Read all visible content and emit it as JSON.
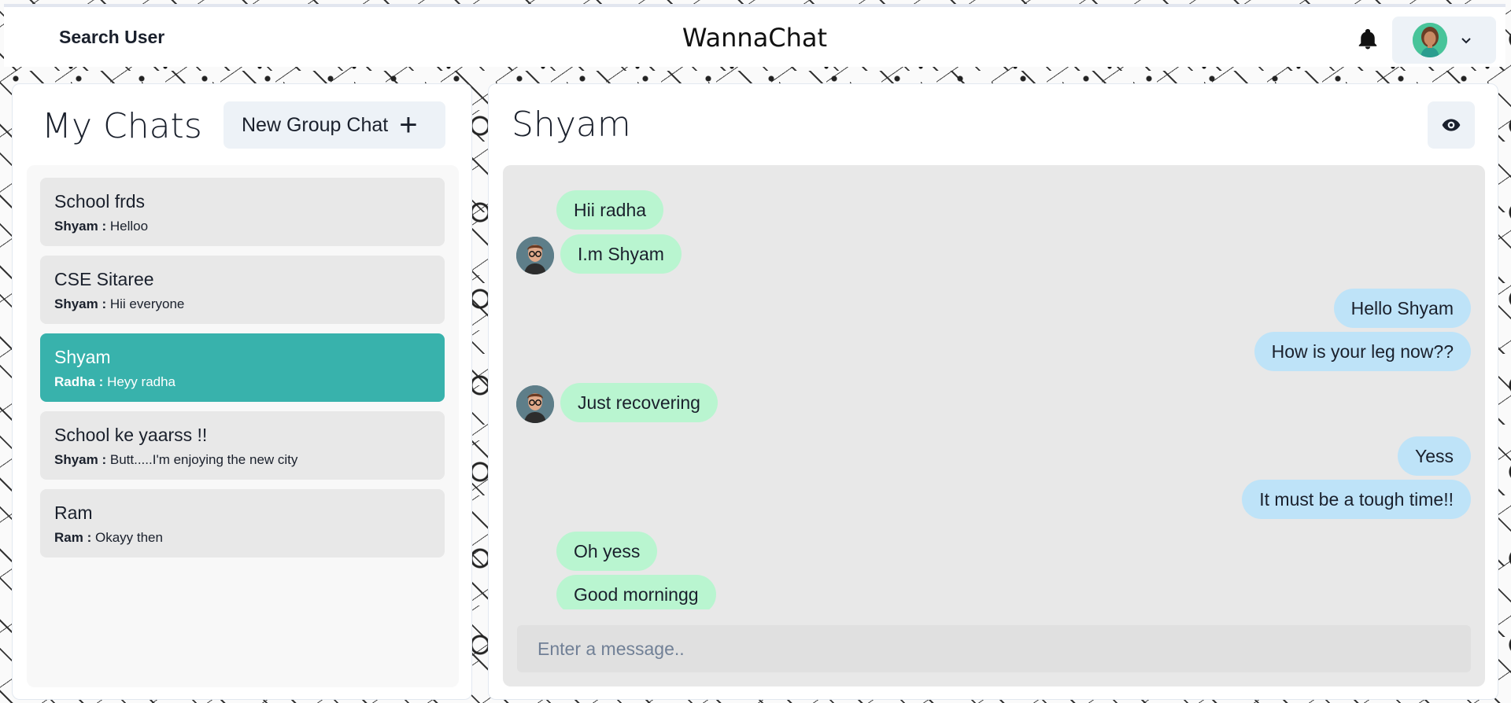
{
  "header": {
    "search_label": "Search User",
    "app_title": "WannaChat",
    "icons": [
      "bell-icon",
      "chevron-down-icon"
    ]
  },
  "left_panel": {
    "title": "My Chats",
    "new_group_label": "New Group Chat",
    "new_group_icon": "+",
    "chats": [
      {
        "name": "School frds",
        "sender": "Shyam :",
        "preview": "Helloo",
        "active": false
      },
      {
        "name": "CSE Sitaree",
        "sender": "Shyam :",
        "preview": "Hii everyone",
        "active": false
      },
      {
        "name": "Shyam",
        "sender": "Radha :",
        "preview": "Heyy radha",
        "active": true
      },
      {
        "name": "School ke yaarss !!",
        "sender": "Shyam :",
        "preview": "Butt.....I'm enjoying the new city",
        "active": false
      },
      {
        "name": "Ram",
        "sender": "Ram :",
        "preview": "Okayy then",
        "active": false
      }
    ]
  },
  "chat": {
    "title": "Shyam",
    "messages": [
      {
        "text": "Hii radha",
        "from": "them"
      },
      {
        "text": "I.m Shyam",
        "from": "them"
      },
      {
        "text": "Hello Shyam",
        "from": "me"
      },
      {
        "text": "How is your leg now??",
        "from": "me"
      },
      {
        "text": "Just recovering",
        "from": "them"
      },
      {
        "text": "Yess",
        "from": "me"
      },
      {
        "text": "It must be a tough time!!",
        "from": "me"
      },
      {
        "text": "Oh yess",
        "from": "them"
      },
      {
        "text": "Good morningg",
        "from": "them"
      }
    ],
    "input_placeholder": "Enter a message.."
  },
  "colors": {
    "active_chat": "#38b2ac",
    "their_bubble": "#b9f5d0",
    "my_bubble": "#bee3f8",
    "button_bg": "#edf2f7"
  }
}
